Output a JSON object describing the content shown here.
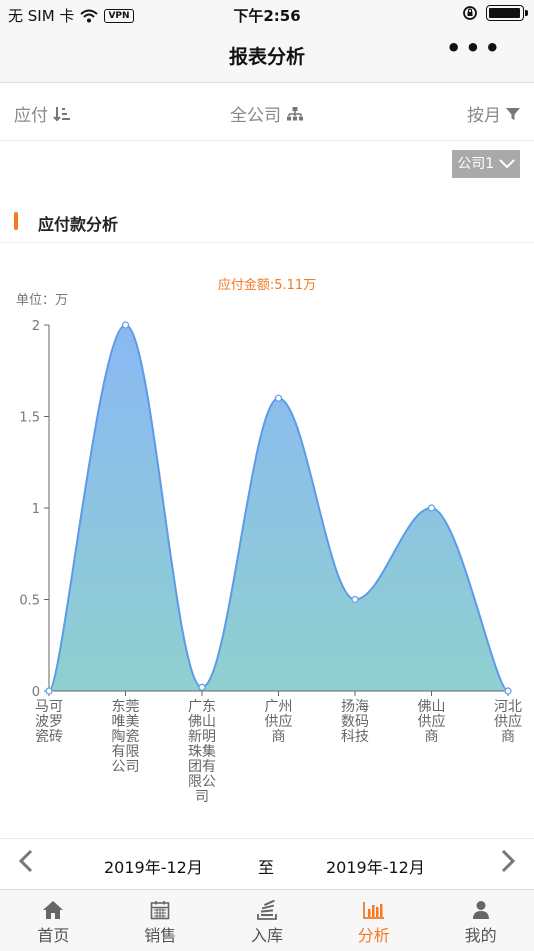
{
  "status": {
    "carrier": "无 SIM 卡",
    "vpn": "VPN",
    "time": "下午2:56"
  },
  "nav": {
    "title": "报表分析",
    "more": "•••"
  },
  "filters": {
    "type": "应付",
    "company": "全公司",
    "period": "按月"
  },
  "company_select": {
    "value": "公司1"
  },
  "section": {
    "title": "应付款分析"
  },
  "chart_header": {
    "unit": "单位：万",
    "total": "应付金额:5.11万"
  },
  "chart_data": {
    "type": "area",
    "categories": [
      "马可波罗瓷砖",
      "东莞唯美陶瓷有限公司",
      "广东佛山新明珠集团有限公司",
      "广州供应商",
      "扬海数码科技",
      "佛山供应商",
      "河北供应商"
    ],
    "values": [
      0,
      2,
      0.02,
      1.6,
      0.5,
      1.0,
      0
    ],
    "ylim": [
      0,
      2
    ],
    "yticks": [
      "0",
      "0.5",
      "1",
      "1.5",
      "2"
    ],
    "grid": false,
    "colors": {
      "line": "#5b9be8",
      "fill_top": "#8ab8f4",
      "fill_bottom": "#8fd0cf"
    }
  },
  "datebar": {
    "from": "2019年-12月",
    "to_label": "至",
    "to": "2019年-12月"
  },
  "tabs": [
    {
      "label": "首页",
      "icon": "home-icon"
    },
    {
      "label": "销售",
      "icon": "calendar-icon"
    },
    {
      "label": "入库",
      "icon": "stack-icon"
    },
    {
      "label": "分析",
      "icon": "bar-chart-icon"
    },
    {
      "label": "我的",
      "icon": "user-icon"
    }
  ],
  "active_tab": "分析",
  "accent": "#f47920"
}
